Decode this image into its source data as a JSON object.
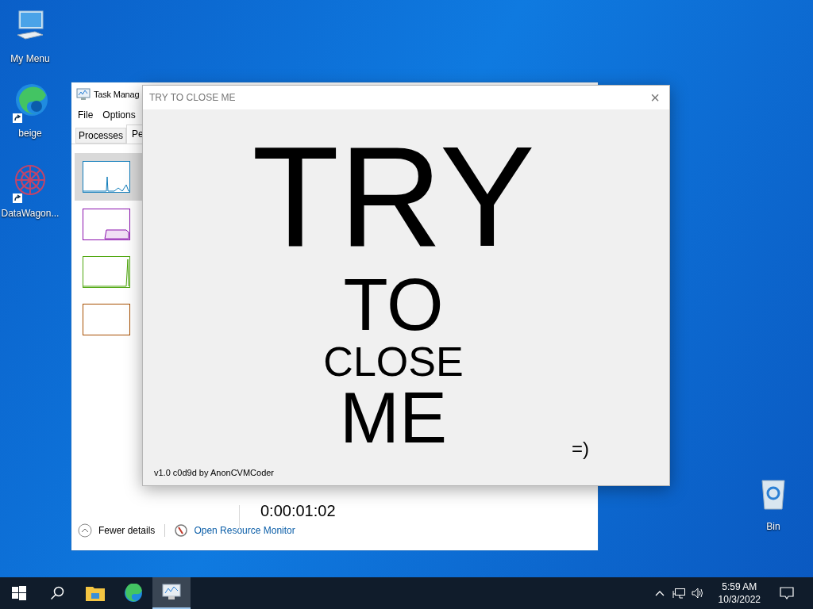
{
  "desktop_icons": [
    {
      "label": "My Menu",
      "kind": "computer",
      "shortcut": false
    },
    {
      "label": "beige",
      "kind": "browser",
      "shortcut": true
    },
    {
      "label": "DataWagon...",
      "kind": "pattern",
      "shortcut": true
    },
    {
      "label": "Bin",
      "kind": "bin",
      "shortcut": false
    }
  ],
  "task_manager": {
    "title": "Task Manag",
    "menu": [
      "File",
      "Options"
    ],
    "tabs": [
      {
        "label": "Processes",
        "selected": false
      },
      {
        "label": "Pe",
        "selected": true
      }
    ],
    "resources": [
      {
        "kind": "cpu",
        "color": "#117dbb",
        "selected": true
      },
      {
        "kind": "memory",
        "color": "#8b12ae",
        "selected": false
      },
      {
        "kind": "disk",
        "color": "#4da60c",
        "selected": false
      },
      {
        "kind": "ethernet",
        "color": "#a74f01",
        "selected": false
      }
    ],
    "uptime": "0:00:01:02",
    "fewer_details": "Fewer details",
    "resource_monitor": "Open Resource Monitor"
  },
  "popup": {
    "title": "TRY TO CLOSE ME",
    "close": "×",
    "lines": [
      "TRY",
      "TO",
      "CLOSE",
      "ME"
    ],
    "smiley": "=)",
    "footer": "v1.0 c0d9d by AnonCVMCoder"
  },
  "taskbar": {
    "apps": [
      {
        "kind": "start",
        "active": false
      },
      {
        "kind": "search",
        "active": false
      },
      {
        "kind": "explorer",
        "active": false
      },
      {
        "kind": "edge",
        "active": false
      },
      {
        "kind": "taskmgr",
        "active": true
      }
    ],
    "time": "5:59 AM",
    "date": "10/3/2022"
  }
}
